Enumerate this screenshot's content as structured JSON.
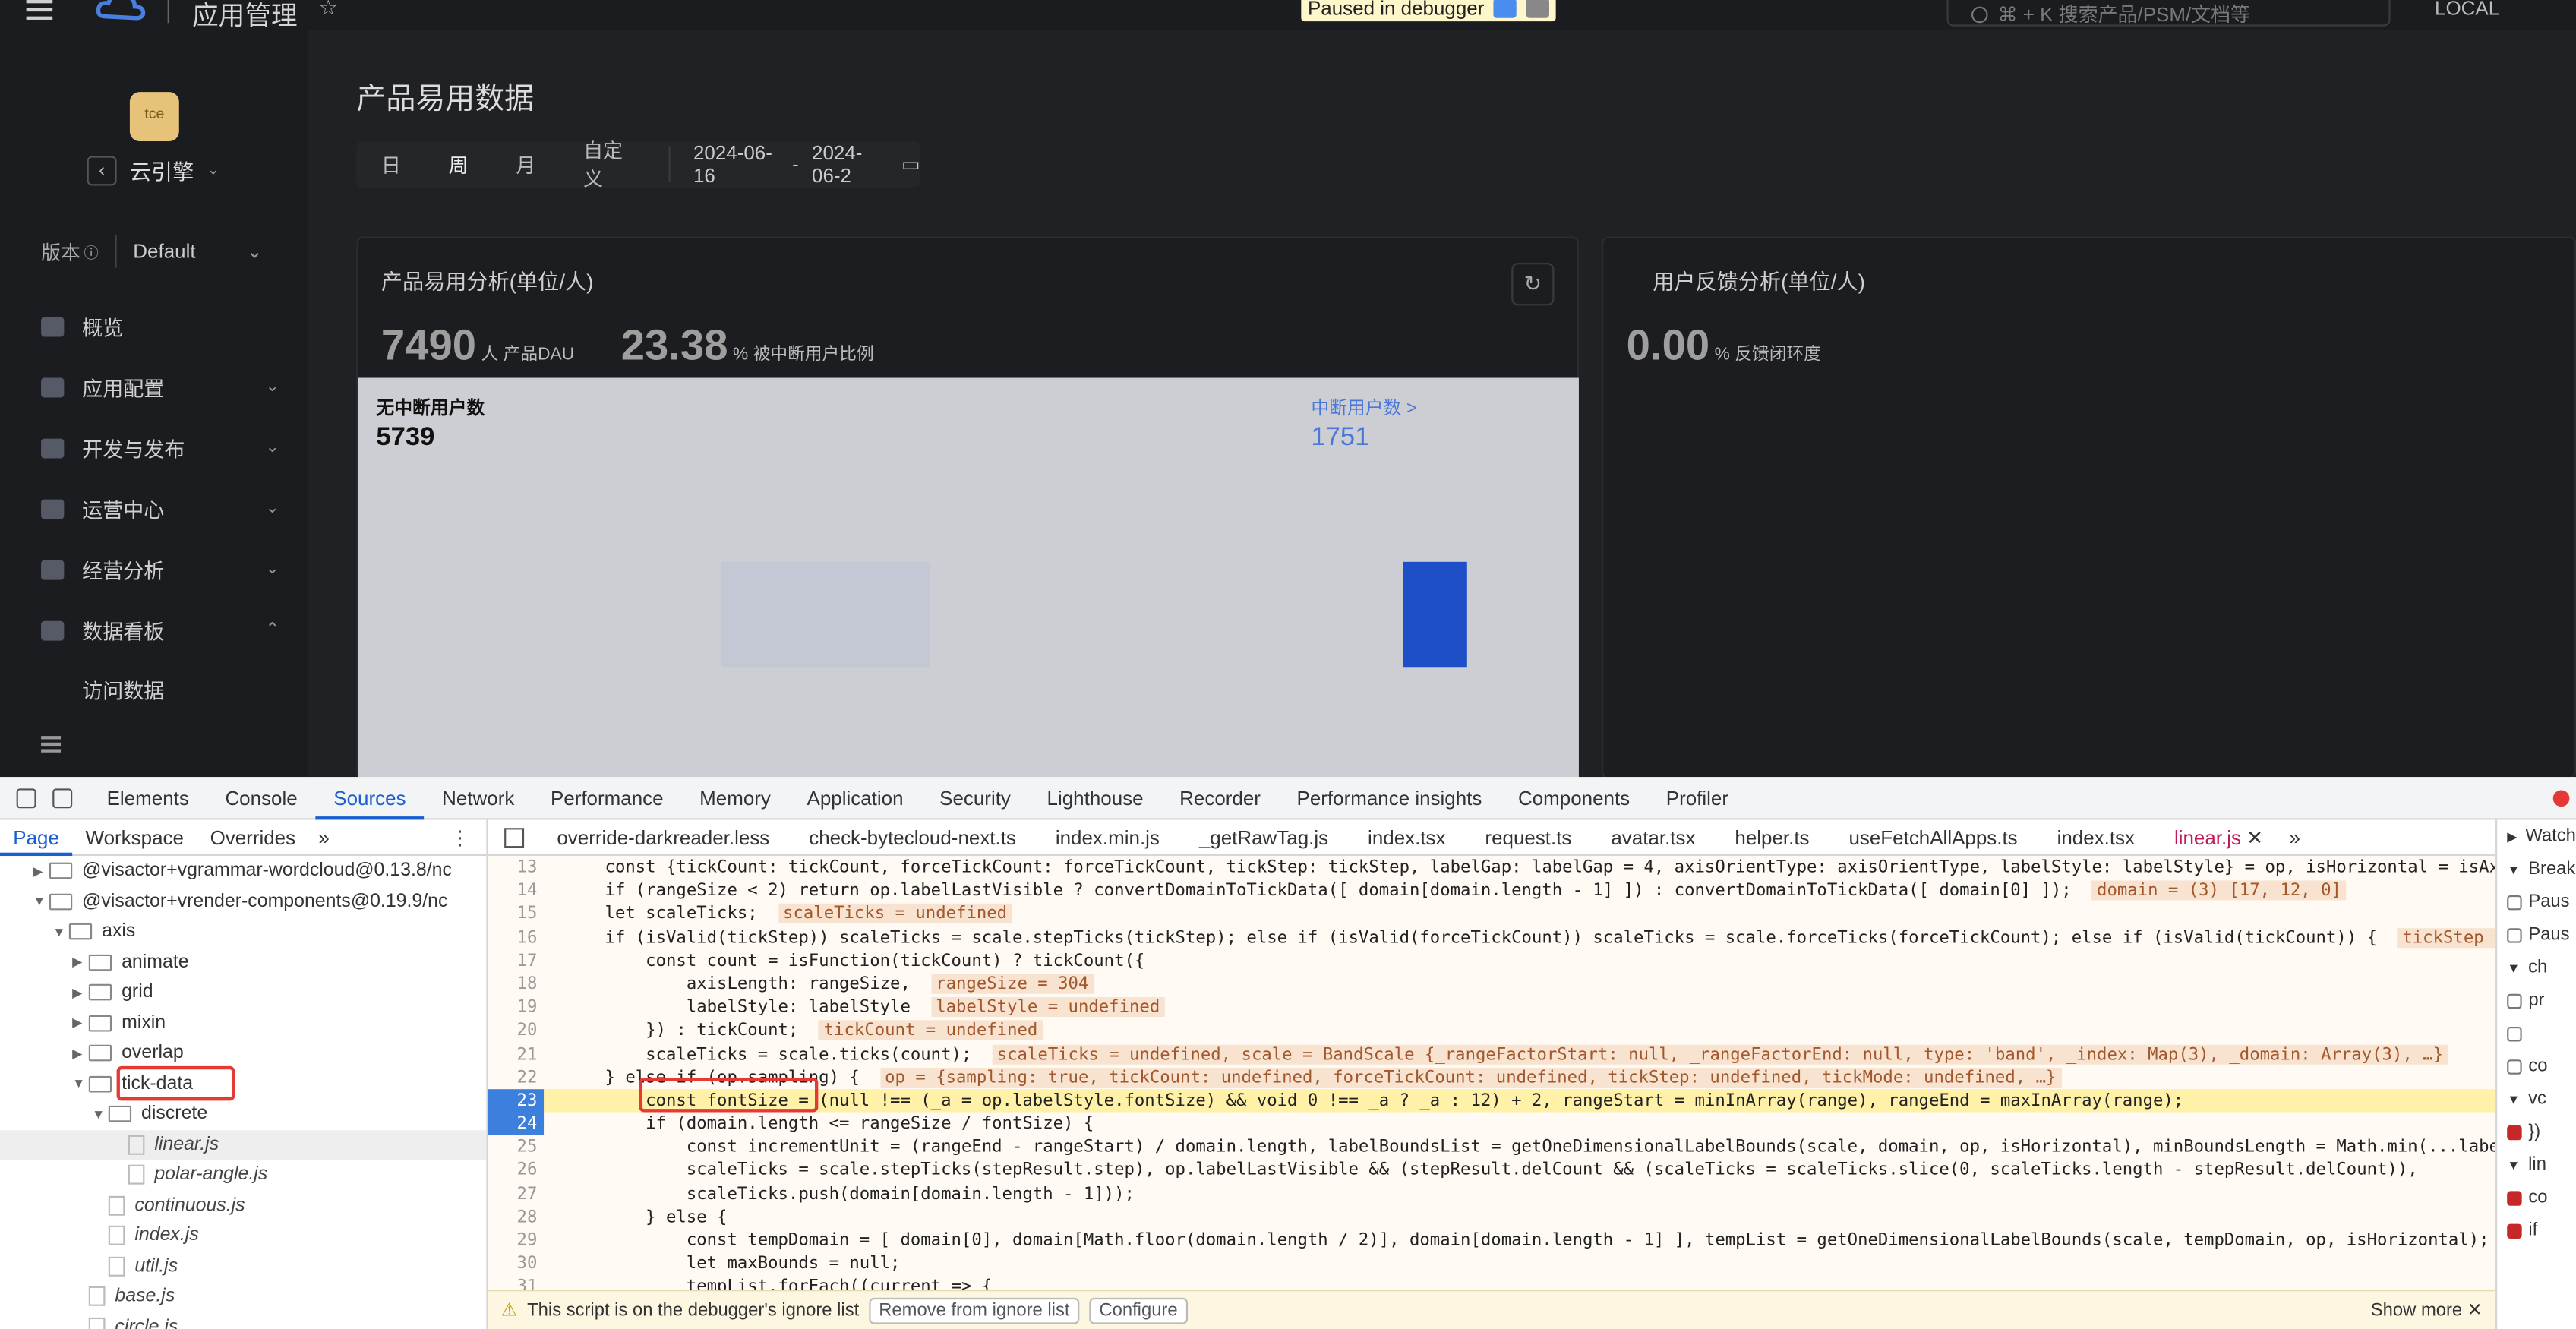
{
  "app": {
    "title": "应用管理",
    "search_placeholder": "⌘ + K 搜索产品/PSM/文档等",
    "env": "LOCAL"
  },
  "debugger": {
    "paused_label": "Paused in debugger"
  },
  "sidebar": {
    "avatar_text": "tce",
    "app_name": "云引擎",
    "version_label": "版本",
    "version_value": "Default",
    "items": [
      {
        "label": "概览",
        "has_children": false
      },
      {
        "label": "应用配置",
        "has_children": true
      },
      {
        "label": "开发与发布",
        "has_children": true
      },
      {
        "label": "运营中心",
        "has_children": true
      },
      {
        "label": "经营分析",
        "has_children": true
      },
      {
        "label": "数据看板",
        "has_children": true,
        "expanded": true
      }
    ],
    "sub_items": [
      {
        "label": "访问数据"
      }
    ]
  },
  "main": {
    "page_title": "产品易用数据",
    "period_tabs": [
      "日",
      "周",
      "月",
      "自定义"
    ],
    "active_period": "周",
    "date_start": "2024-06-16",
    "date_sep": "-",
    "date_end": "2024-06-2",
    "cards": [
      {
        "title": "产品易用分析(单位/人)",
        "kpis": [
          {
            "value": "7490",
            "unit": "人",
            "label": "产品DAU"
          },
          {
            "value": "23.38",
            "unit": "%",
            "label": "被中断用户比例"
          }
        ],
        "chart_left_label": "无中断用户数",
        "chart_left_value": "5739",
        "chart_right_label": "中断用户数 >",
        "chart_right_value": "1751"
      },
      {
        "title": "用户反馈分析(单位/人)",
        "kpis": [
          {
            "value": "0.00",
            "unit": "%",
            "label": "反馈闭环度"
          }
        ]
      }
    ]
  },
  "chart_data": {
    "type": "bar",
    "categories": [
      "无中断用户数",
      "中断用户数"
    ],
    "values": [
      5739,
      1751
    ],
    "colors": [
      "#c3c8d4",
      "#1e4fc9"
    ]
  },
  "devtools": {
    "tabs": [
      "Elements",
      "Console",
      "Sources",
      "Network",
      "Performance",
      "Memory",
      "Application",
      "Security",
      "Lighthouse",
      "Recorder",
      "Performance insights",
      "Components",
      "Profiler"
    ],
    "active_tab": "Sources",
    "navigator_tabs": [
      "Page",
      "Workspace",
      "Overrides"
    ],
    "tree": [
      {
        "depth": 2,
        "type": "folder",
        "name": "@visactor+vgrammar-wordcloud@0.13.8/nc",
        "open": false
      },
      {
        "depth": 2,
        "type": "folder",
        "name": "@visactor+vrender-components@0.19.9/nc",
        "open": true
      },
      {
        "depth": 3,
        "type": "folder",
        "name": "axis",
        "open": true
      },
      {
        "depth": 4,
        "type": "folder",
        "name": "animate",
        "open": false
      },
      {
        "depth": 4,
        "type": "folder",
        "name": "grid",
        "open": false
      },
      {
        "depth": 4,
        "type": "folder",
        "name": "mixin",
        "open": false
      },
      {
        "depth": 4,
        "type": "folder",
        "name": "overlap",
        "open": false
      },
      {
        "depth": 4,
        "type": "folder",
        "name": "tick-data",
        "open": true
      },
      {
        "depth": 5,
        "type": "folder",
        "name": "discrete",
        "open": true
      },
      {
        "depth": 6,
        "type": "file",
        "name": "linear.js",
        "selected": true
      },
      {
        "depth": 6,
        "type": "file",
        "name": "polar-angle.js"
      },
      {
        "depth": 5,
        "type": "file",
        "name": "continuous.js"
      },
      {
        "depth": 5,
        "type": "file",
        "name": "index.js"
      },
      {
        "depth": 5,
        "type": "file",
        "name": "util.js"
      },
      {
        "depth": 4,
        "type": "file",
        "name": "base.js"
      },
      {
        "depth": 4,
        "type": "file",
        "name": "circle.js"
      }
    ],
    "editor_tabs": [
      "override-darkreader.less",
      "check-bytecloud-next.ts",
      "index.min.js",
      "_getRawTag.js",
      "index.tsx",
      "request.ts",
      "avatar.tsx",
      "helper.ts",
      "useFetchAllApps.ts",
      "index.tsx",
      "linear.js"
    ],
    "active_editor_tab": "linear.js",
    "code_lines": [
      {
        "n": "13",
        "code": "    const {tickCount: tickCount, forceTickCount: forceTickCount, tickStep: tickStep, labelGap: labelGap = 4, axisOrientType: axisOrientType, labelStyle: labelStyle} = op, isHorizontal = isAxi",
        "inline": ""
      },
      {
        "n": "14",
        "code": "    if (rangeSize < 2) return op.labelLastVisible ? convertDomainToTickData([ domain[domain.length - 1] ]) : convertDomainToTickData([ domain[0] ]);",
        "inline": "domain = (3) [17, 12, 0]"
      },
      {
        "n": "15",
        "code": "    let scaleTicks;",
        "inline": "scaleTicks = undefined"
      },
      {
        "n": "16",
        "code": "    if (isValid(tickStep)) scaleTicks = scale.stepTicks(tickStep); else if (isValid(forceTickCount)) scaleTicks = scale.forceTicks(forceTickCount); else if (isValid(tickCount)) {",
        "inline": "tickStep ="
      },
      {
        "n": "17",
        "code": "        const count = isFunction(tickCount) ? tickCount({",
        "inline": ""
      },
      {
        "n": "18",
        "code": "            axisLength: rangeSize,",
        "inline": "rangeSize = 304"
      },
      {
        "n": "19",
        "code": "            labelStyle: labelStyle",
        "inline": "labelStyle = undefined"
      },
      {
        "n": "20",
        "code": "        }) : tickCount;",
        "inline": "tickCount = undefined"
      },
      {
        "n": "21",
        "code": "        scaleTicks = scale.ticks(count);",
        "inline": "scaleTicks = undefined, scale = BandScale {_rangeFactorStart: null, _rangeFactorEnd: null, type: 'band', _index: Map(3), _domain: Array(3), …}"
      },
      {
        "n": "22",
        "code": "    } else if (op.sampling) {",
        "inline": "op = {sampling: true, tickCount: undefined, forceTickCount: undefined, tickStep: undefined, tickMode: undefined, …}"
      },
      {
        "n": "23",
        "code": "        const fontSize = (null !== (_a = op.labelStyle.fontSize) && void 0 !== _a ? _a : 12) + 2, rangeStart = minInArray(range), rangeEnd = maxInArray(range);",
        "inline": "",
        "highlight": true,
        "bp": true
      },
      {
        "n": "24",
        "code": "        if (domain.length <= rangeSize / fontSize) {",
        "inline": "",
        "bp": true
      },
      {
        "n": "25",
        "code": "            const incrementUnit = (rangeEnd - rangeStart) / domain.length, labelBoundsList = getOneDimensionalLabelBounds(scale, domain, op, isHorizontal), minBoundsLength = Math.min(...label",
        "inline": ""
      },
      {
        "n": "26",
        "code": "            scaleTicks = scale.stepTicks(stepResult.step), op.labelLastVisible && (stepResult.delCount && (scaleTicks = scaleTicks.slice(0, scaleTicks.length - stepResult.delCount)),",
        "inline": ""
      },
      {
        "n": "27",
        "code": "            scaleTicks.push(domain[domain.length - 1]));",
        "inline": ""
      },
      {
        "n": "28",
        "code": "        } else {",
        "inline": ""
      },
      {
        "n": "29",
        "code": "            const tempDomain = [ domain[0], domain[Math.floor(domain.length / 2)], domain[domain.length - 1] ], tempList = getOneDimensionalLabelBounds(scale, tempDomain, op, isHorizontal);",
        "inline": ""
      },
      {
        "n": "30",
        "code": "            let maxBounds = null;",
        "inline": ""
      },
      {
        "n": "31",
        "code": "            tempList.forEach((current => {",
        "inline": ""
      }
    ],
    "ignore_warning": "This script is on the debugger's ignore list",
    "remove_ignore_label": "Remove from ignore list",
    "configure_label": "Configure",
    "show_more_label": "Show more",
    "right_panel": [
      {
        "type": "section",
        "label": "Watch",
        "open": false
      },
      {
        "type": "section",
        "label": "Break",
        "open": true
      },
      {
        "type": "check",
        "label": "Paus",
        "checked": false
      },
      {
        "type": "check",
        "label": "Paus",
        "checked": false
      },
      {
        "type": "section",
        "label": "ch",
        "open": true
      },
      {
        "type": "check",
        "label": "pr",
        "checked": false
      },
      {
        "type": "check",
        "label": "",
        "checked": false
      },
      {
        "type": "check",
        "label": "co",
        "checked": false
      },
      {
        "type": "section",
        "label": "vc",
        "open": true
      },
      {
        "type": "check",
        "label": "})",
        "checked": true
      },
      {
        "type": "section",
        "label": "lin",
        "open": true
      },
      {
        "type": "check",
        "label": "co",
        "checked": true
      },
      {
        "type": "check",
        "label": "if",
        "checked": true
      }
    ]
  }
}
